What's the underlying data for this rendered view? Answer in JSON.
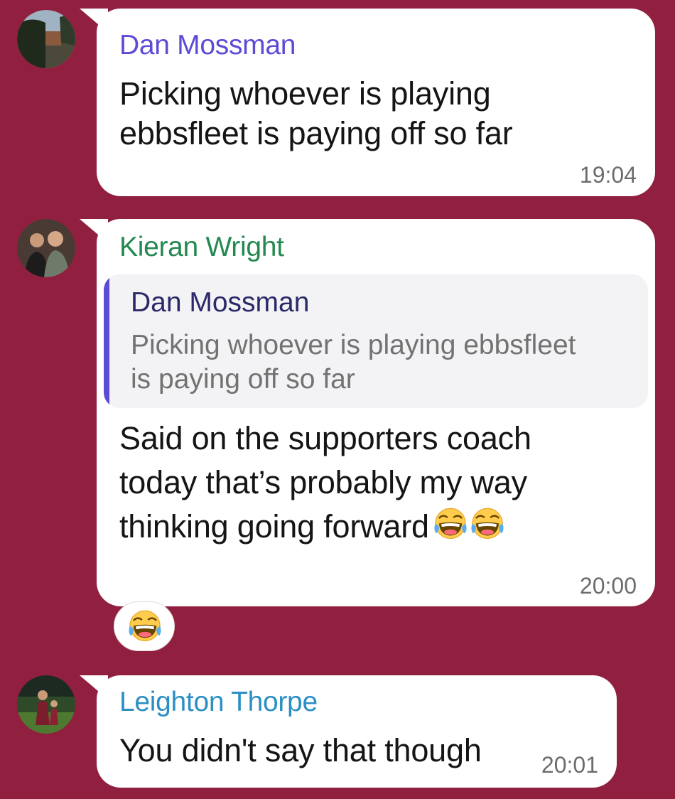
{
  "messages": [
    {
      "sender": "Dan Mossman",
      "lines": [
        "Picking whoever is playing",
        "ebbsfleet is paying off so far"
      ],
      "time": "19:04"
    },
    {
      "sender": "Kieran Wright",
      "reply": {
        "sender": "Dan Mossman",
        "lines": [
          "Picking whoever is playing ebbsfleet",
          "is paying off so far"
        ]
      },
      "lines": [
        "Said on the supporters coach",
        "today that’s probably my way",
        "thinking going forward"
      ],
      "inline_emojis": [
        "face-with-tears-of-joy",
        "face-with-tears-of-joy"
      ],
      "reaction": "face-with-tears-of-joy",
      "time": "20:00"
    },
    {
      "sender": "Leighton Thorpe",
      "lines": [
        "You didn't say that though"
      ],
      "time": "20:01"
    }
  ],
  "colors": {
    "background": "#912040",
    "bubble": "#ffffff",
    "sender_dan": "#5b4bd6",
    "sender_kieran": "#23894f",
    "sender_leighton": "#2b8fc4",
    "reply_bar": "#5b4bd6",
    "timestamp": "#6c6c6c"
  }
}
